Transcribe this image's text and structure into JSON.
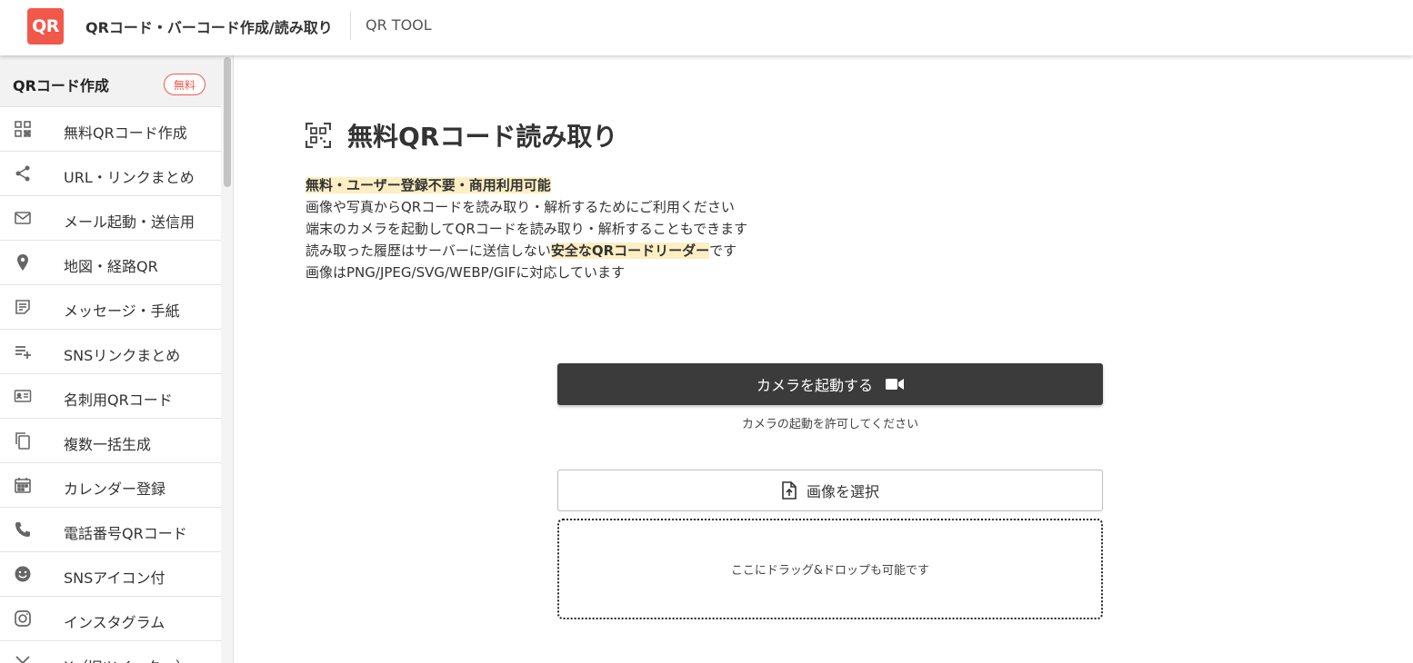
{
  "header": {
    "logo_text": "QR",
    "logo_color": "#f2584a",
    "site_title": "QRコード・バーコード作成/読み取り",
    "site_sub": "QR TOOL"
  },
  "sidebar": {
    "heading": "QRコード作成",
    "badge": "無料",
    "items": [
      {
        "label": "無料QRコード作成",
        "icon": "qr-grid-icon"
      },
      {
        "label": "URL・リンクまとめ",
        "icon": "share-icon"
      },
      {
        "label": "メール起動・送信用",
        "icon": "mail-icon"
      },
      {
        "label": "地図・経路QR",
        "icon": "map-pin-icon"
      },
      {
        "label": "メッセージ・手紙",
        "icon": "note-icon"
      },
      {
        "label": "SNSリンクまとめ",
        "icon": "playlist-add-icon"
      },
      {
        "label": "名刺用QRコード",
        "icon": "business-card-icon"
      },
      {
        "label": "複数一括生成",
        "icon": "copy-icon"
      },
      {
        "label": "カレンダー登録",
        "icon": "calendar-icon"
      },
      {
        "label": "電話番号QRコード",
        "icon": "phone-icon"
      },
      {
        "label": "SNSアイコン付",
        "icon": "smiley-icon"
      },
      {
        "label": "インスタグラム",
        "icon": "instagram-icon"
      },
      {
        "label": "X（旧ツイッター）",
        "icon": "x-icon"
      }
    ]
  },
  "main": {
    "title": "無料QRコード読み取り",
    "title_icon": "qr-scan-icon",
    "desc": {
      "highlight_line": "無料・ユーザー登録不要・商用利用可能",
      "line2": "画像や写真からQRコードを読み取り・解析するためにご利用ください",
      "line3": "端末のカメラを起動してQRコードを読み取り・解析することもできます",
      "line4_pre": "読み取った履歴はサーバーに送信しない",
      "line4_hl": "安全なQRコードリーダー",
      "line4_post": "です",
      "line5": "画像はPNG/JPEG/SVG/WEBP/GIFに対応しています"
    },
    "camera_button": "カメラを起動する",
    "camera_note": "カメラの起動を許可してください",
    "select_button": "画像を選択",
    "drop_text": "ここにドラッグ&ドロップも可能です"
  }
}
